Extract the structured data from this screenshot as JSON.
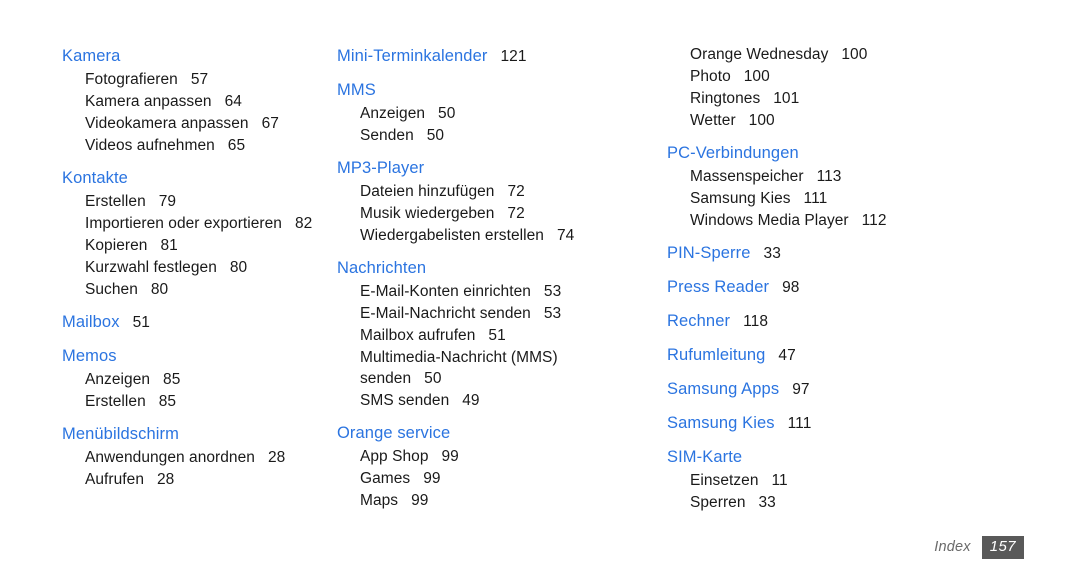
{
  "document": {
    "type": "index-page",
    "footer": {
      "label": "Index",
      "page_number": "157"
    },
    "colors": {
      "heading_blue": "#2b74e0",
      "body_text": "#1a1a1a",
      "footer_label": "#6a6a6a",
      "footer_badge_bg": "#595959",
      "footer_badge_text": "#ffffff",
      "page_background": "#ffffff"
    }
  },
  "columns": [
    {
      "id": "column-1",
      "sections": [
        {
          "heading": "Kamera",
          "page": "",
          "entries": [
            {
              "label": "Fotografieren",
              "page": "57"
            },
            {
              "label": "Kamera anpassen",
              "page": "64"
            },
            {
              "label": "Videokamera anpassen",
              "page": "67"
            },
            {
              "label": "Videos aufnehmen",
              "page": "65"
            }
          ]
        },
        {
          "heading": "Kontakte",
          "page": "",
          "entries": [
            {
              "label": "Erstellen",
              "page": "79"
            },
            {
              "label": "Importieren oder exportieren",
              "page": "82"
            },
            {
              "label": "Kopieren",
              "page": "81"
            },
            {
              "label": "Kurzwahl festlegen",
              "page": "80"
            },
            {
              "label": "Suchen",
              "page": "80"
            }
          ]
        },
        {
          "heading": "Mailbox",
          "page": "51",
          "entries": []
        },
        {
          "heading": "Memos",
          "page": "",
          "entries": [
            {
              "label": "Anzeigen",
              "page": "85"
            },
            {
              "label": "Erstellen",
              "page": "85"
            }
          ]
        },
        {
          "heading": "Menübildschirm",
          "page": "",
          "entries": [
            {
              "label": "Anwendungen anordnen",
              "page": "28"
            },
            {
              "label": "Aufrufen",
              "page": "28"
            }
          ]
        }
      ]
    },
    {
      "id": "column-2",
      "sections": [
        {
          "heading": "Mini-Terminkalender",
          "page": "121",
          "entries": []
        },
        {
          "heading": "MMS",
          "page": "",
          "entries": [
            {
              "label": "Anzeigen",
              "page": "50"
            },
            {
              "label": "Senden",
              "page": "50"
            }
          ]
        },
        {
          "heading": "MP3-Player",
          "page": "",
          "entries": [
            {
              "label": "Dateien hinzufügen",
              "page": "72"
            },
            {
              "label": "Musik wiedergeben",
              "page": "72"
            },
            {
              "label": "Wiedergabelisten erstellen",
              "page": "74"
            }
          ]
        },
        {
          "heading": "Nachrichten",
          "page": "",
          "entries": [
            {
              "label": "E-Mail-Konten einrichten",
              "page": "53"
            },
            {
              "label": "E-Mail-Nachricht senden",
              "page": "53"
            },
            {
              "label": "Mailbox aufrufen",
              "page": "51"
            },
            {
              "label": "Multimedia-Nachricht (MMS)",
              "page": "",
              "wrapped": true
            },
            {
              "label": "senden",
              "page": "50",
              "continuation": true
            },
            {
              "label": "SMS senden",
              "page": "49"
            }
          ]
        },
        {
          "heading": "Orange service",
          "page": "",
          "entries": [
            {
              "label": "App Shop",
              "page": "99"
            },
            {
              "label": "Games",
              "page": "99"
            },
            {
              "label": "Maps",
              "page": "99"
            }
          ]
        }
      ]
    },
    {
      "id": "column-3",
      "continued_entries": [
        {
          "label": "Orange Wednesday",
          "page": "100"
        },
        {
          "label": "Photo",
          "page": "100"
        },
        {
          "label": "Ringtones",
          "page": "101"
        },
        {
          "label": "Wetter",
          "page": "100"
        }
      ],
      "sections": [
        {
          "heading": "PC-Verbindungen",
          "page": "",
          "entries": [
            {
              "label": "Massenspeicher",
              "page": "113"
            },
            {
              "label": "Samsung Kies",
              "page": "111"
            },
            {
              "label": "Windows Media Player",
              "page": "112"
            }
          ]
        },
        {
          "heading": "PIN-Sperre",
          "page": "33",
          "entries": []
        },
        {
          "heading": "Press Reader",
          "page": "98",
          "entries": []
        },
        {
          "heading": "Rechner",
          "page": "118",
          "entries": []
        },
        {
          "heading": "Rufumleitung",
          "page": "47",
          "entries": []
        },
        {
          "heading": "Samsung Apps",
          "page": "97",
          "entries": []
        },
        {
          "heading": "Samsung Kies",
          "page": "111",
          "entries": []
        },
        {
          "heading": "SIM-Karte",
          "page": "",
          "entries": [
            {
              "label": "Einsetzen",
              "page": "11"
            },
            {
              "label": "Sperren",
              "page": "33"
            }
          ]
        }
      ]
    }
  ]
}
